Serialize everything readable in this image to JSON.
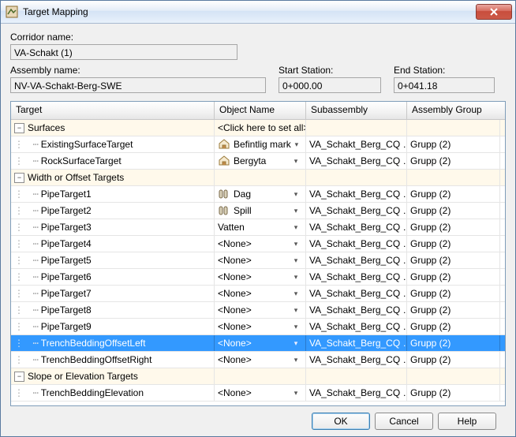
{
  "window_title": "Target Mapping",
  "labels": {
    "corridor_name": "Corridor name:",
    "assembly_name": "Assembly name:",
    "start_station": "Start Station:",
    "end_station": "End Station:"
  },
  "values": {
    "corridor_name": "VA-Schakt (1)",
    "assembly_name": "NV-VA-Schakt-Berg-SWE",
    "start_station": "0+000.00",
    "end_station": "0+041.18"
  },
  "columns": {
    "target": "Target",
    "object_name": "Object Name",
    "subassembly": "Subassembly",
    "assembly_group": "Assembly Group"
  },
  "click_all": "<Click here to set all>",
  "none": "<None>",
  "sub_value": "VA_Schakt_Berg_CQ …",
  "grp_value": "Grupp (2)",
  "categories": {
    "surfaces": "Surfaces",
    "width_offset": "Width or Offset Targets",
    "slope_elev": "Slope or Elevation Targets"
  },
  "rows": {
    "s1": {
      "name": "ExistingSurfaceTarget",
      "obj": "Befintlig mark"
    },
    "s2": {
      "name": "RockSurfaceTarget",
      "obj": "Bergyta"
    },
    "w1": {
      "name": "PipeTarget1",
      "obj": "Dag"
    },
    "w2": {
      "name": "PipeTarget2",
      "obj": "Spill"
    },
    "w3": {
      "name": "PipeTarget3",
      "obj": "Vatten"
    },
    "w4": {
      "name": "PipeTarget4"
    },
    "w5": {
      "name": "PipeTarget5"
    },
    "w6": {
      "name": "PipeTarget6"
    },
    "w7": {
      "name": "PipeTarget7"
    },
    "w8": {
      "name": "PipeTarget8"
    },
    "w9": {
      "name": "PipeTarget9"
    },
    "w10": {
      "name": "TrenchBeddingOffsetLeft"
    },
    "w11": {
      "name": "TrenchBeddingOffsetRight"
    },
    "e1": {
      "name": "TrenchBeddingElevation"
    }
  },
  "buttons": {
    "ok": "OK",
    "cancel": "Cancel",
    "help": "Help"
  }
}
